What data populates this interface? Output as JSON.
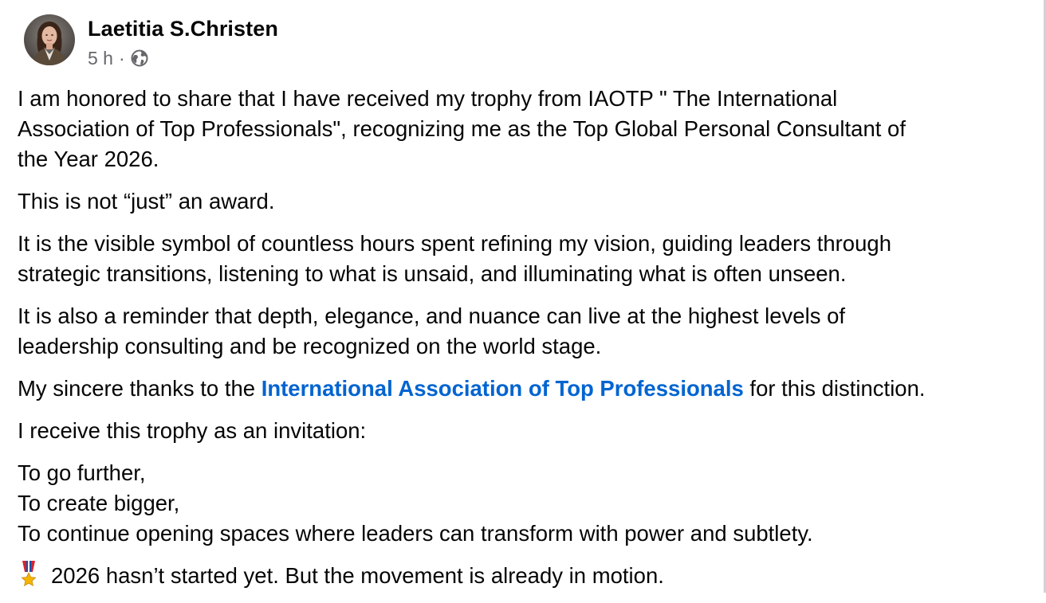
{
  "post": {
    "author": "Laetitia S.Christen",
    "time": "5 h",
    "separator": "·",
    "audience_icon": "globe-icon",
    "avatar_icon": "profile-photo",
    "paragraphs": {
      "p1": {
        "l1": "I am honored to share that I have received my trophy from IAOTP \" The International",
        "l2": "Association of Top Professionals\", recognizing me as the Top Global Personal Consultant of",
        "l3": "the Year 2026."
      },
      "p2": "This is not “just” an award.",
      "p3": {
        "l1": "It is the visible symbol of countless hours spent refining my vision, guiding leaders through",
        "l2": "strategic transitions, listening to what is unsaid, and illuminating what is often unseen."
      },
      "p4": {
        "l1": "It is also a reminder that depth, elegance, and nuance can live at the highest levels of",
        "l2": "leadership consulting and be recognized on the world stage."
      },
      "p5": {
        "before": "My sincere thanks to the ",
        "mention": "International Association of Top Professionals",
        "after": " for this distinction."
      },
      "p6": "I receive this trophy as an invitation:",
      "p7": {
        "l1": "To go further,",
        "l2": "To create bigger,",
        "l3": "To continue opening spaces where leaders can transform with power and subtlety."
      },
      "p8": {
        "emoji_icon": "military-medal-icon",
        "text": "2026 hasn’t started yet. But the movement is already in motion."
      }
    },
    "colors": {
      "text": "#050505",
      "secondary": "#65676b",
      "link": "#0064d1"
    }
  }
}
